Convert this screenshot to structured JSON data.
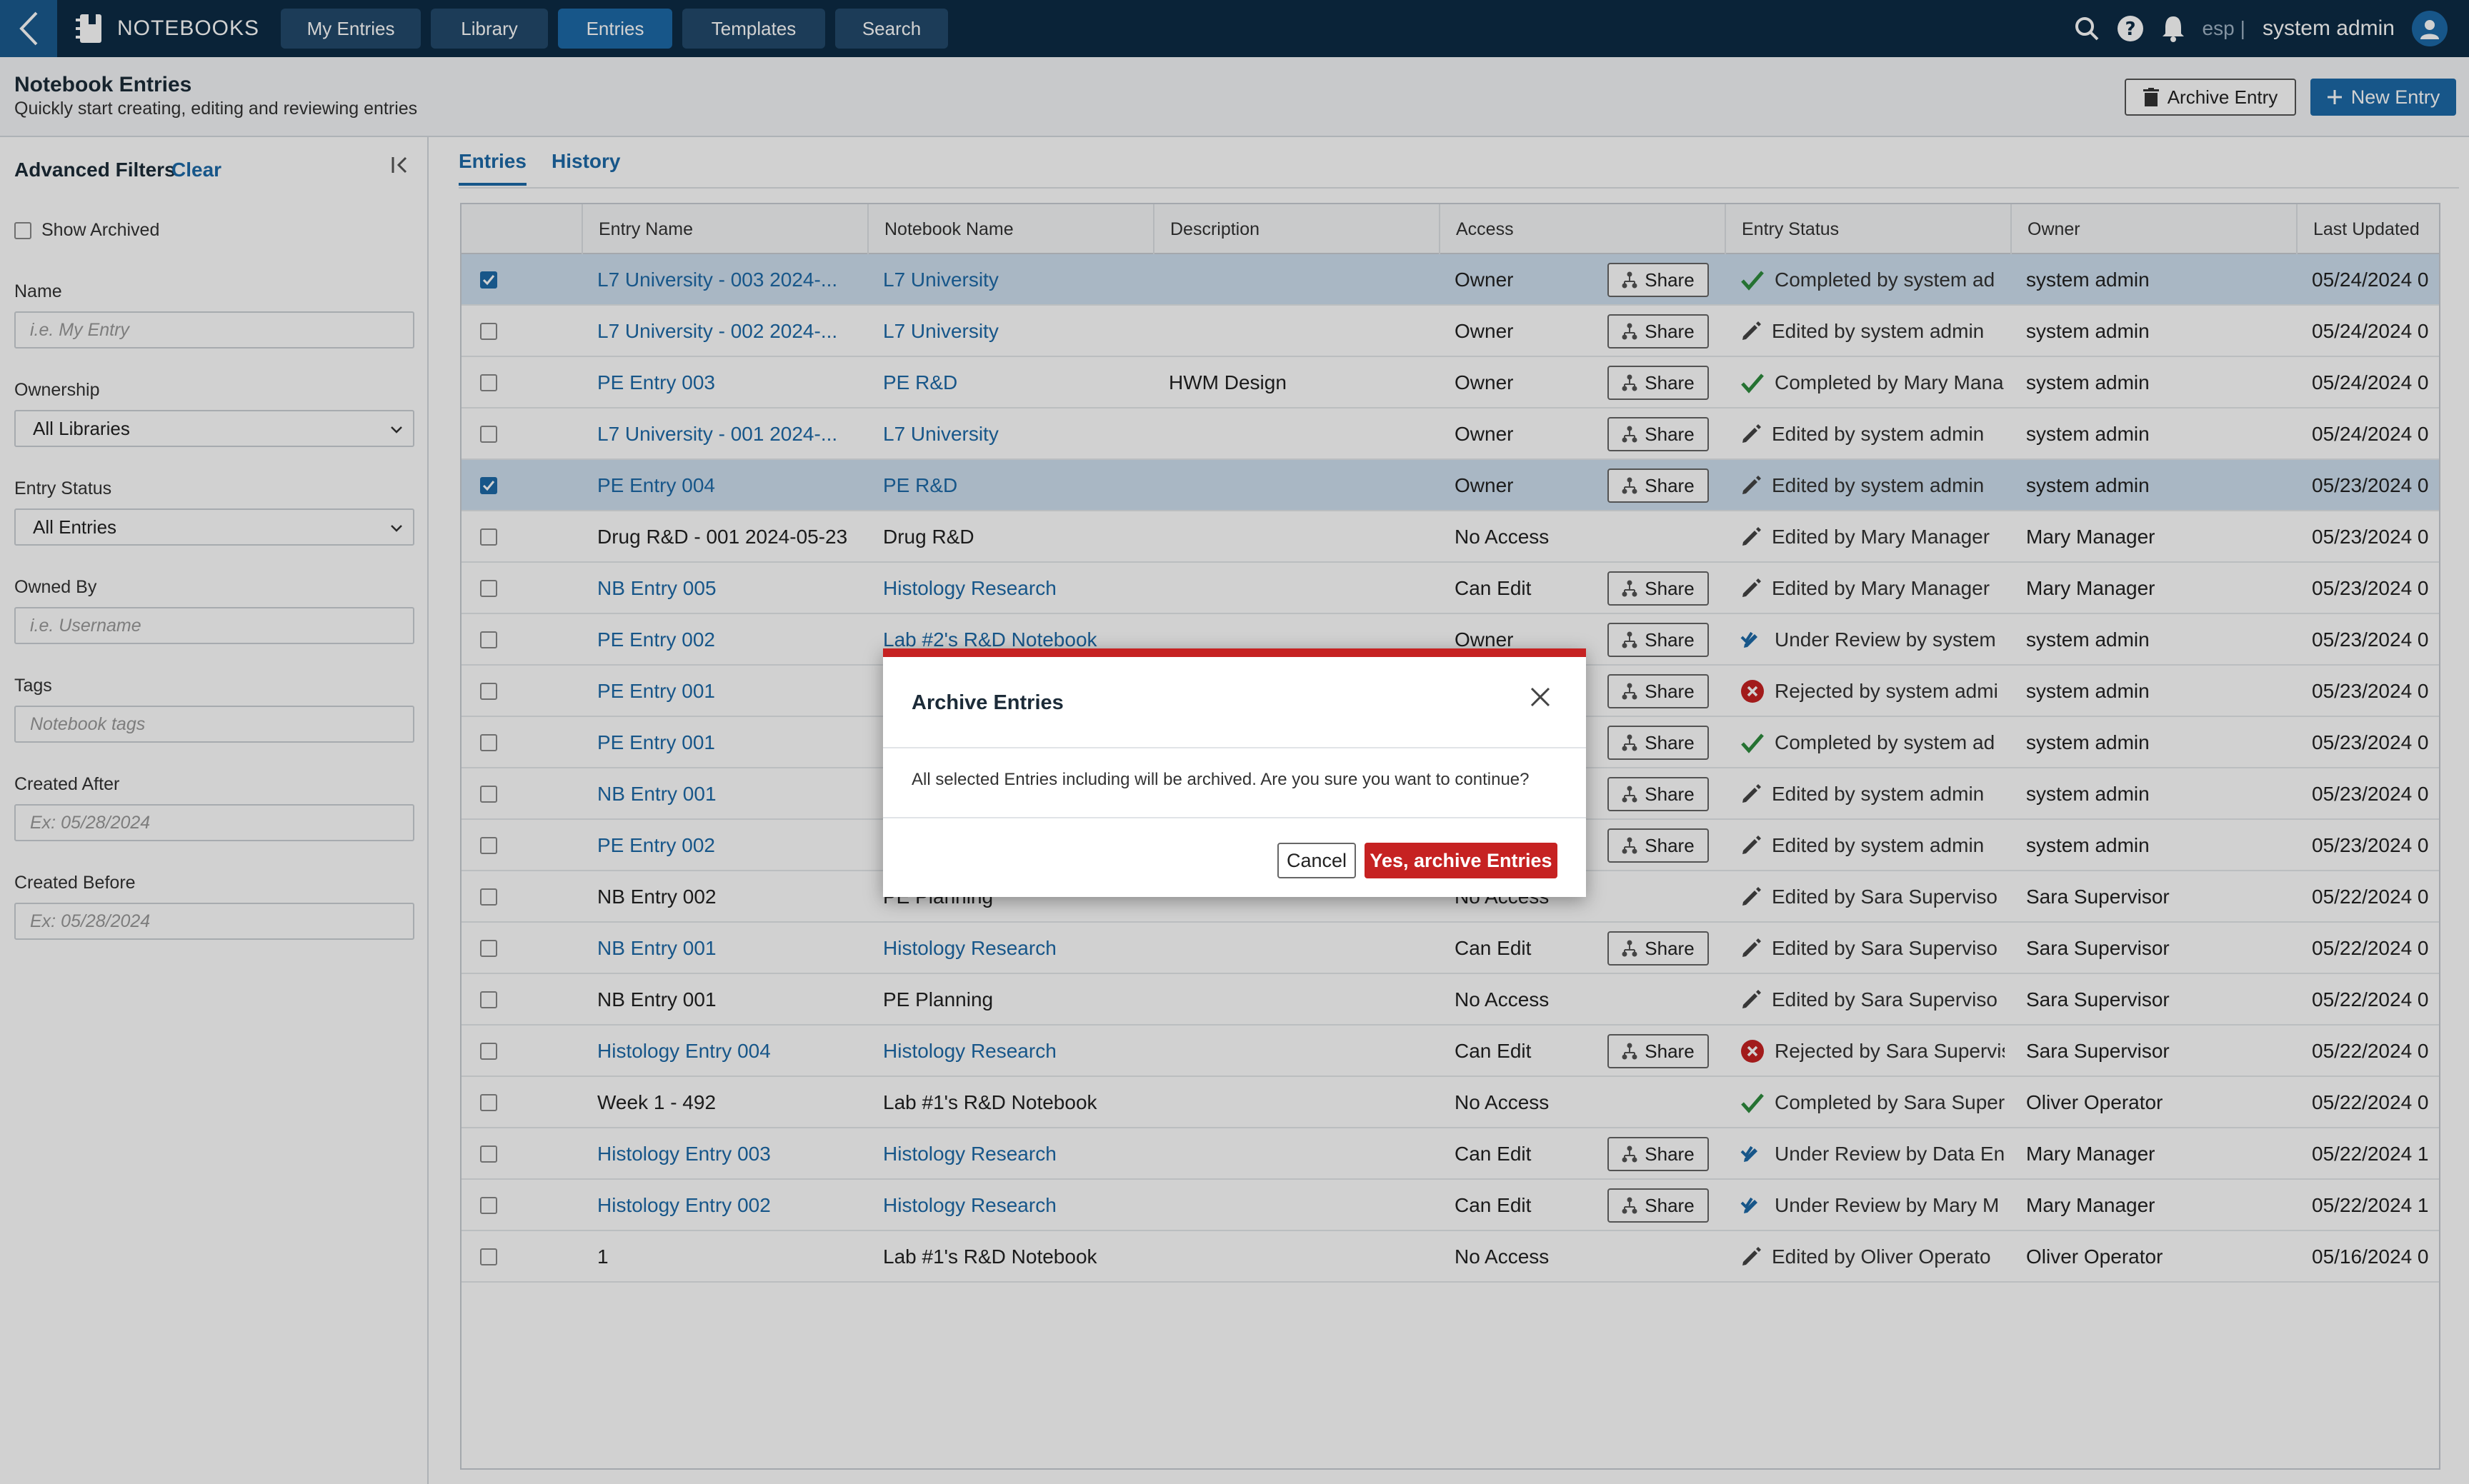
{
  "app": {
    "brand": "NOTEBOOKS"
  },
  "nav": {
    "tabs": [
      "My Entries",
      "Library",
      "Entries",
      "Templates",
      "Search"
    ]
  },
  "topbar": {
    "lang": "esp",
    "separator": "|",
    "user": "system admin"
  },
  "header": {
    "title": "Notebook Entries",
    "subtitle": "Quickly start creating, editing and reviewing entries",
    "archive_label": "Archive Entry",
    "new_label": "New Entry"
  },
  "filters": {
    "title": "Advanced Filters",
    "clear": "Clear",
    "show_archived": "Show Archived",
    "name_label": "Name",
    "name_placeholder": "i.e. My Entry",
    "ownership_label": "Ownership",
    "ownership_value": "All Libraries",
    "status_label": "Entry Status",
    "status_value": "All Entries",
    "owned_label": "Owned By",
    "owned_placeholder": "i.e. Username",
    "tags_label": "Tags",
    "tags_placeholder": "Notebook tags",
    "after_label": "Created After",
    "after_placeholder": "Ex: 05/28/2024",
    "before_label": "Created Before",
    "before_placeholder": "Ex: 05/28/2024"
  },
  "subtabs": [
    "Entries",
    "History"
  ],
  "table": {
    "headers": [
      "Entry Name",
      "Notebook Name",
      "Description",
      "Access",
      "Entry Status",
      "Owner",
      "Last Updated"
    ],
    "share_label": "Share",
    "rows": [
      {
        "name": "L7 University - 003 2024-...",
        "notebook": "L7 University",
        "desc": "",
        "access": "Owner",
        "status": "Completed by system ad",
        "status_type": "completed",
        "owner": "system admin",
        "updated": "05/24/2024 0",
        "link": true,
        "share": true,
        "selected": true
      },
      {
        "name": "L7 University - 002 2024-...",
        "notebook": "L7 University",
        "desc": "",
        "access": "Owner",
        "status": "Edited by system admin",
        "status_type": "edited",
        "owner": "system admin",
        "updated": "05/24/2024 0",
        "link": true,
        "share": true,
        "selected": false
      },
      {
        "name": "PE Entry 003",
        "notebook": "PE R&D",
        "desc": "HWM Design",
        "access": "Owner",
        "status": "Completed by Mary Mana",
        "status_type": "completed",
        "owner": "system admin",
        "updated": "05/24/2024 0",
        "link": true,
        "share": true,
        "selected": false
      },
      {
        "name": "L7 University - 001 2024-...",
        "notebook": "L7 University",
        "desc": "",
        "access": "Owner",
        "status": "Edited by system admin",
        "status_type": "edited",
        "owner": "system admin",
        "updated": "05/24/2024 0",
        "link": true,
        "share": true,
        "selected": false
      },
      {
        "name": "PE Entry 004",
        "notebook": "PE R&D",
        "desc": "",
        "access": "Owner",
        "status": "Edited by system admin",
        "status_type": "edited",
        "owner": "system admin",
        "updated": "05/23/2024 0",
        "link": true,
        "share": true,
        "selected": true
      },
      {
        "name": "Drug R&D - 001 2024-05-23",
        "notebook": "Drug R&D",
        "desc": "",
        "access": "No Access",
        "status": "Edited by Mary Manager",
        "status_type": "edited",
        "owner": "Mary Manager",
        "updated": "05/23/2024 0",
        "link": false,
        "share": false,
        "selected": false
      },
      {
        "name": "NB Entry 005",
        "notebook": "Histology Research",
        "desc": "",
        "access": "Can Edit",
        "status": "Edited by Mary Manager",
        "status_type": "edited",
        "owner": "Mary Manager",
        "updated": "05/23/2024 0",
        "link": true,
        "share": true,
        "selected": false
      },
      {
        "name": "PE Entry 002",
        "notebook": "Lab #2's R&D Notebook",
        "desc": "",
        "access": "Owner",
        "status": "Under Review by system",
        "status_type": "review",
        "owner": "system admin",
        "updated": "05/23/2024 0",
        "link": true,
        "share": true,
        "selected": false
      },
      {
        "name": "PE Entry 001",
        "notebook": "",
        "desc": "",
        "access": "",
        "status": "Rejected by system admi",
        "status_type": "rejected",
        "owner": "system admin",
        "updated": "05/23/2024 0",
        "link": true,
        "share": true,
        "selected": false
      },
      {
        "name": "PE Entry 001",
        "notebook": "",
        "desc": "",
        "access": "",
        "status": "Completed by system ad",
        "status_type": "completed",
        "owner": "system admin",
        "updated": "05/23/2024 0",
        "link": true,
        "share": true,
        "selected": false
      },
      {
        "name": "NB Entry 001",
        "notebook": "",
        "desc": "",
        "access": "",
        "status": "Edited by system admin",
        "status_type": "edited",
        "owner": "system admin",
        "updated": "05/23/2024 0",
        "link": true,
        "share": true,
        "selected": false
      },
      {
        "name": "PE Entry 002",
        "notebook": "",
        "desc": "",
        "access": "",
        "status": "Edited by system admin",
        "status_type": "edited",
        "owner": "system admin",
        "updated": "05/23/2024 0",
        "link": true,
        "share": true,
        "selected": false
      },
      {
        "name": "NB Entry 002",
        "notebook": "PE Planning",
        "desc": "",
        "access": "No Access",
        "status": "Edited by Sara Superviso",
        "status_type": "edited",
        "owner": "Sara Supervisor",
        "updated": "05/22/2024 0",
        "link": false,
        "share": false,
        "selected": false
      },
      {
        "name": "NB Entry 001",
        "notebook": "Histology Research",
        "desc": "",
        "access": "Can Edit",
        "status": "Edited by Sara Superviso",
        "status_type": "edited",
        "owner": "Sara Supervisor",
        "updated": "05/22/2024 0",
        "link": true,
        "share": true,
        "selected": false
      },
      {
        "name": "NB Entry 001",
        "notebook": "PE Planning",
        "desc": "",
        "access": "No Access",
        "status": "Edited by Sara Superviso",
        "status_type": "edited",
        "owner": "Sara Supervisor",
        "updated": "05/22/2024 0",
        "link": false,
        "share": false,
        "selected": false
      },
      {
        "name": "Histology Entry 004",
        "notebook": "Histology Research",
        "desc": "",
        "access": "Can Edit",
        "status": "Rejected by Sara Supervis",
        "status_type": "rejected",
        "owner": "Sara Supervisor",
        "updated": "05/22/2024 0",
        "link": true,
        "share": true,
        "selected": false
      },
      {
        "name": "Week 1 - 492",
        "notebook": "Lab #1's R&D Notebook",
        "desc": "",
        "access": "No Access",
        "status": "Completed by Sara Super",
        "status_type": "completed",
        "owner": "Oliver Operator",
        "updated": "05/22/2024 0",
        "link": false,
        "share": false,
        "selected": false
      },
      {
        "name": "Histology Entry 003",
        "notebook": "Histology Research",
        "desc": "",
        "access": "Can Edit",
        "status": "Under Review by Data En",
        "status_type": "review",
        "owner": "Mary Manager",
        "updated": "05/22/2024 1",
        "link": true,
        "share": true,
        "selected": false
      },
      {
        "name": "Histology Entry 002",
        "notebook": "Histology Research",
        "desc": "",
        "access": "Can Edit",
        "status": "Under Review by Mary M",
        "status_type": "review",
        "owner": "Mary Manager",
        "updated": "05/22/2024 1",
        "link": true,
        "share": true,
        "selected": false
      },
      {
        "name": "1",
        "notebook": "Lab #1's R&D Notebook",
        "desc": "",
        "access": "No Access",
        "status": "Edited by Oliver Operato",
        "status_type": "edited",
        "owner": "Oliver Operator",
        "updated": "05/16/2024 0",
        "link": false,
        "share": false,
        "selected": false
      }
    ]
  },
  "modal": {
    "title": "Archive Entries",
    "body": "All selected Entries including will be archived. Are you sure you want to continue?",
    "cancel": "Cancel",
    "confirm": "Yes, archive Entries"
  },
  "colors": {
    "nav_bg": "#0d2b45",
    "accent": "#1d6aa8",
    "danger": "#c62222",
    "success": "#2e8b3e",
    "selected_row": "#cfe0ef"
  }
}
